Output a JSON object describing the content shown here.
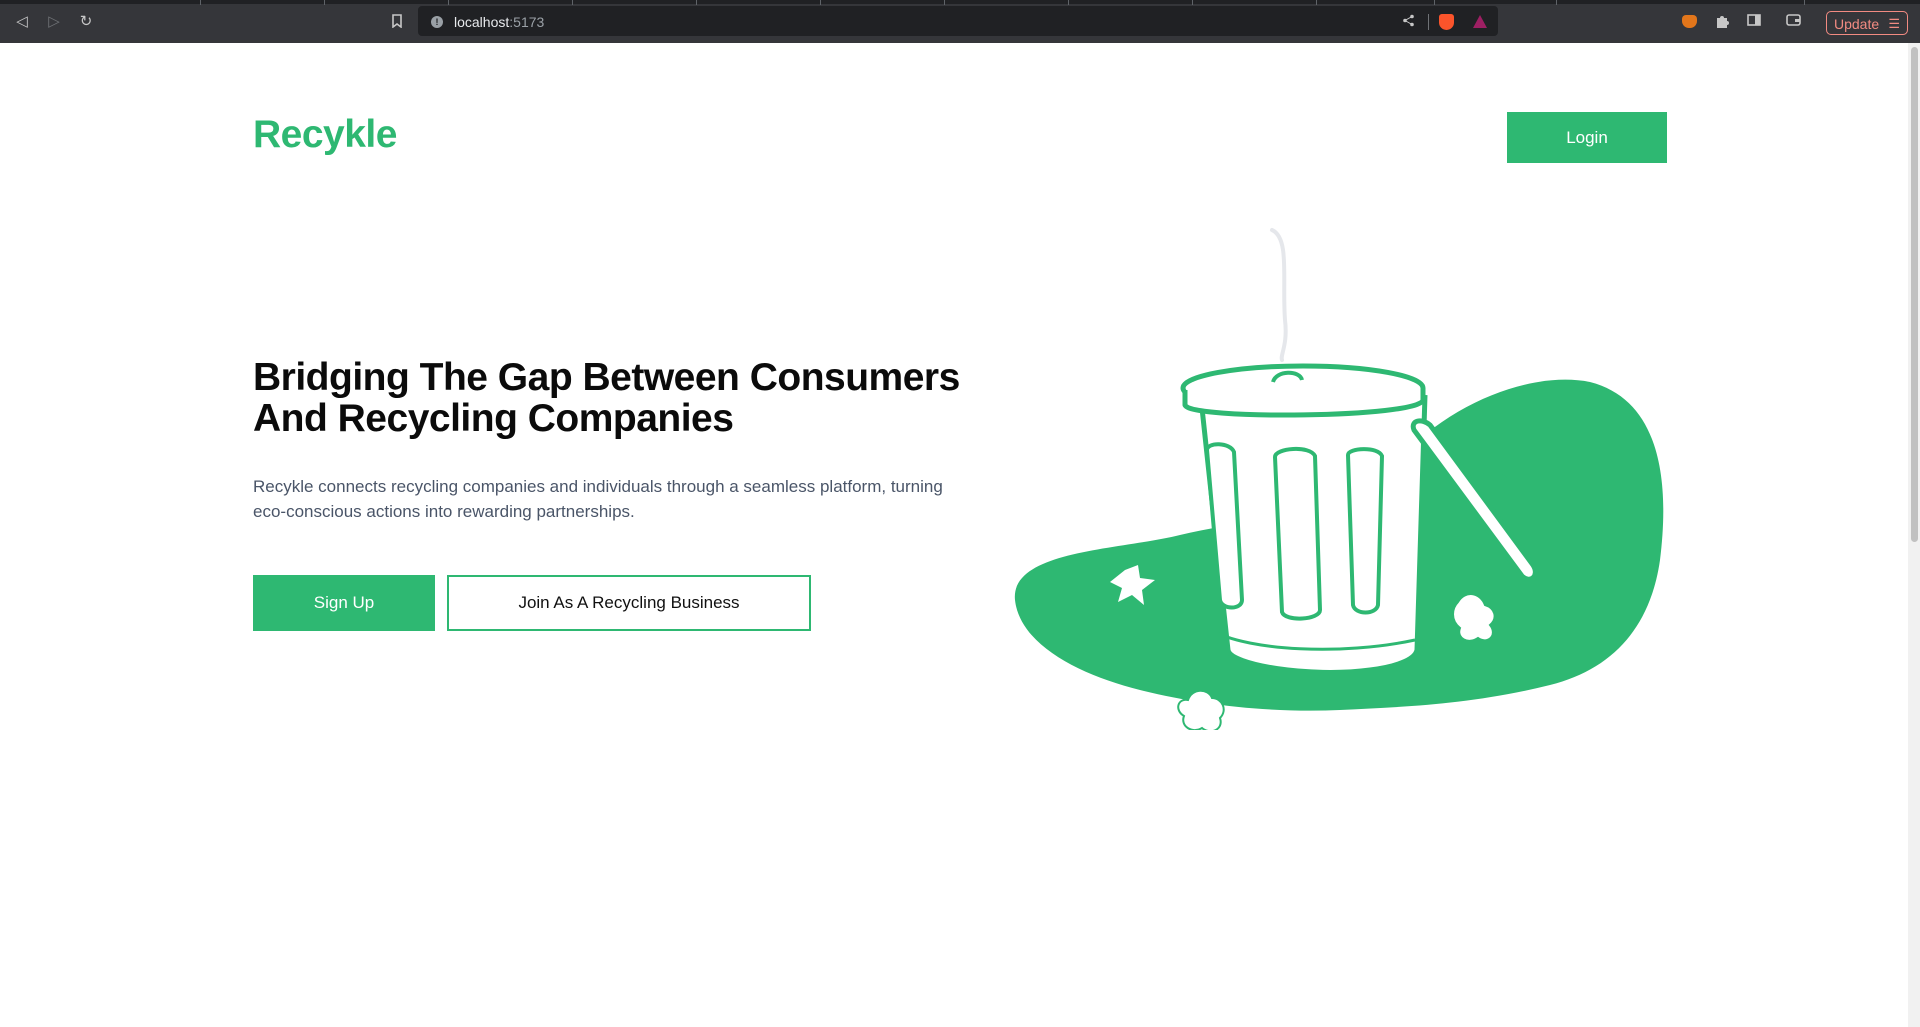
{
  "browser": {
    "url_host": "localhost",
    "url_port": ":5173",
    "update_label": "Update",
    "update_menu_icon": "☰"
  },
  "header": {
    "logo": "Recykle",
    "login_label": "Login"
  },
  "hero": {
    "headline": "Bridging The Gap Between Consumers And Recycling Companies",
    "description": "Recykle connects recycling companies and individuals through a seamless platform, turning eco-conscious actions into rewarding partnerships.",
    "signup_label": "Sign Up",
    "business_label": "Join As A Recycling Business"
  },
  "colors": {
    "brand_green": "#2eb872",
    "headline": "#0b0b0b",
    "body_text": "#4a5568"
  },
  "icons": {
    "back": "back-icon",
    "forward": "forward-icon",
    "reload": "reload-icon",
    "bookmark": "bookmark-icon",
    "share": "share-icon",
    "illustration": "trash-can-illustration"
  }
}
